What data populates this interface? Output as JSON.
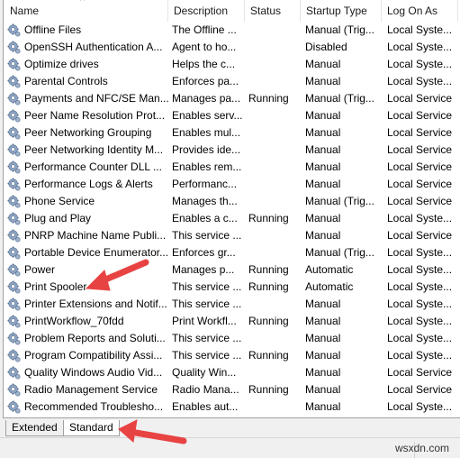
{
  "columns": [
    "Name",
    "Description",
    "Status",
    "Startup Type",
    "Log On As"
  ],
  "rows": [
    [
      "Offline Files",
      "The Offline ...",
      "",
      "Manual (Trig...",
      "Local Syste..."
    ],
    [
      "OpenSSH Authentication A...",
      "Agent to ho...",
      "",
      "Disabled",
      "Local Syste..."
    ],
    [
      "Optimize drives",
      "Helps the c...",
      "",
      "Manual",
      "Local Syste..."
    ],
    [
      "Parental Controls",
      "Enforces pa...",
      "",
      "Manual",
      "Local Syste..."
    ],
    [
      "Payments and NFC/SE Man...",
      "Manages pa...",
      "Running",
      "Manual (Trig...",
      "Local Service"
    ],
    [
      "Peer Name Resolution Prot...",
      "Enables serv...",
      "",
      "Manual",
      "Local Service"
    ],
    [
      "Peer Networking Grouping",
      "Enables mul...",
      "",
      "Manual",
      "Local Service"
    ],
    [
      "Peer Networking Identity M...",
      "Provides ide...",
      "",
      "Manual",
      "Local Service"
    ],
    [
      "Performance Counter DLL ...",
      "Enables rem...",
      "",
      "Manual",
      "Local Service"
    ],
    [
      "Performance Logs & Alerts",
      "Performanc...",
      "",
      "Manual",
      "Local Service"
    ],
    [
      "Phone Service",
      "Manages th...",
      "",
      "Manual (Trig...",
      "Local Service"
    ],
    [
      "Plug and Play",
      "Enables a c...",
      "Running",
      "Manual",
      "Local Syste..."
    ],
    [
      "PNRP Machine Name Publi...",
      "This service ...",
      "",
      "Manual",
      "Local Service"
    ],
    [
      "Portable Device Enumerator...",
      "Enforces gr...",
      "",
      "Manual (Trig...",
      "Local Syste..."
    ],
    [
      "Power",
      "Manages p...",
      "Running",
      "Automatic",
      "Local Syste..."
    ],
    [
      "Print Spooler",
      "This service ...",
      "Running",
      "Automatic",
      "Local Syste..."
    ],
    [
      "Printer Extensions and Notif...",
      "This service ...",
      "",
      "Manual",
      "Local Syste..."
    ],
    [
      "PrintWorkflow_70fdd",
      "Print Workfl...",
      "Running",
      "Manual",
      "Local Syste..."
    ],
    [
      "Problem Reports and Soluti...",
      "This service ...",
      "",
      "Manual",
      "Local Syste..."
    ],
    [
      "Program Compatibility Assi...",
      "This service ...",
      "Running",
      "Manual",
      "Local Syste..."
    ],
    [
      "Quality Windows Audio Vid...",
      "Quality Win...",
      "",
      "Manual",
      "Local Service"
    ],
    [
      "Radio Management Service",
      "Radio Mana...",
      "Running",
      "Manual",
      "Local Service"
    ],
    [
      "Recommended Troublesho...",
      "Enables aut...",
      "",
      "Manual",
      "Local Syste..."
    ]
  ],
  "tabs": [
    {
      "label": "Extended",
      "active": false
    },
    {
      "label": "Standard",
      "active": true
    }
  ],
  "watermark": "wsxdn.com",
  "icons": {
    "row": "service-gear-icon",
    "sort": "sort-ascending-icon"
  },
  "colors": {
    "annotation_arrow": "#e84343"
  }
}
